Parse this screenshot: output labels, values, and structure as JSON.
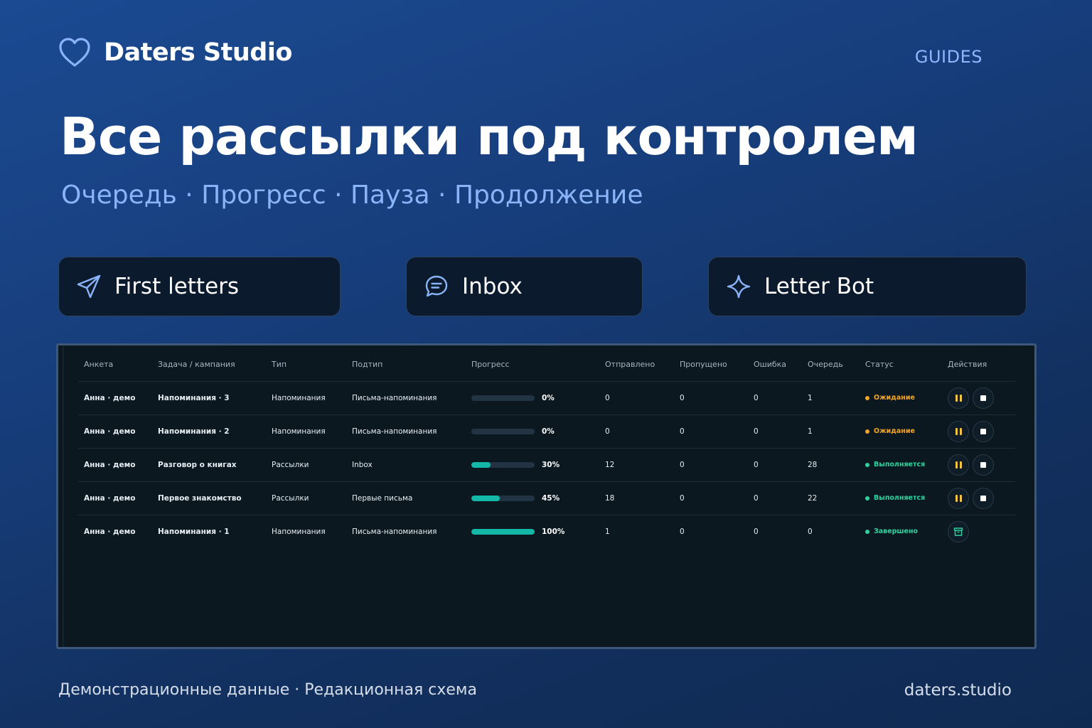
{
  "header": {
    "brand": "Daters Studio",
    "nav_link": "GUIDES"
  },
  "hero": {
    "title": "Все рассылки под контролем",
    "subtitle": "Очередь · Прогресс · Пауза · Продолжение"
  },
  "cards": [
    {
      "label": "First letters",
      "icon": "send-icon"
    },
    {
      "label": "Inbox",
      "icon": "chat-bubble-icon"
    },
    {
      "label": "Letter Bot",
      "icon": "sparkle-icon"
    }
  ],
  "table": {
    "columns": [
      "Анкета",
      "Задача / кампания",
      "Тип",
      "Подтип",
      "Прогресс",
      "Отправлено",
      "Пропущено",
      "Ошибка",
      "Очередь",
      "Статус",
      "Действия"
    ],
    "rows": [
      {
        "profile": "Анна · демо",
        "task": "Напоминания · 3",
        "type": "Напоминания",
        "subtype": "Письма-напоминания",
        "progress": 0,
        "progress_label": "0%",
        "sent": "0",
        "skipped": "0",
        "error": "0",
        "queue": "1",
        "status": "Ожидание",
        "status_kind": "wait",
        "actions": [
          "pause",
          "stop"
        ]
      },
      {
        "profile": "Анна · демо",
        "task": "Напоминания · 2",
        "type": "Напоминания",
        "subtype": "Письма-напоминания",
        "progress": 0,
        "progress_label": "0%",
        "sent": "0",
        "skipped": "0",
        "error": "0",
        "queue": "1",
        "status": "Ожидание",
        "status_kind": "wait",
        "actions": [
          "pause",
          "stop"
        ]
      },
      {
        "profile": "Анна · демо",
        "task": "Разговор о книгах",
        "type": "Рассылки",
        "subtype": "Inbox",
        "progress": 30,
        "progress_label": "30%",
        "sent": "12",
        "skipped": "0",
        "error": "0",
        "queue": "28",
        "status": "Выполняется",
        "status_kind": "run",
        "actions": [
          "pause",
          "stop"
        ]
      },
      {
        "profile": "Анна · демо",
        "task": "Первое знакомство",
        "type": "Рассылки",
        "subtype": "Первые письма",
        "progress": 45,
        "progress_label": "45%",
        "sent": "18",
        "skipped": "0",
        "error": "0",
        "queue": "22",
        "status": "Выполняется",
        "status_kind": "run",
        "actions": [
          "pause",
          "stop"
        ]
      },
      {
        "profile": "Анна · демо",
        "task": "Напоминания · 1",
        "type": "Напоминания",
        "subtype": "Письма-напоминания",
        "progress": 100,
        "progress_label": "100%",
        "sent": "1",
        "skipped": "0",
        "error": "0",
        "queue": "0",
        "status": "Завершено",
        "status_kind": "done",
        "actions": [
          "archive"
        ]
      }
    ]
  },
  "footer": {
    "left": "Демонстрационные данные · Редакционная схема",
    "right": "daters.studio"
  },
  "colors": {
    "accent": "#8ab4f8",
    "progress": "#14b8a6",
    "status_wait": "#f5a524",
    "status_run": "#2ed3a0"
  }
}
